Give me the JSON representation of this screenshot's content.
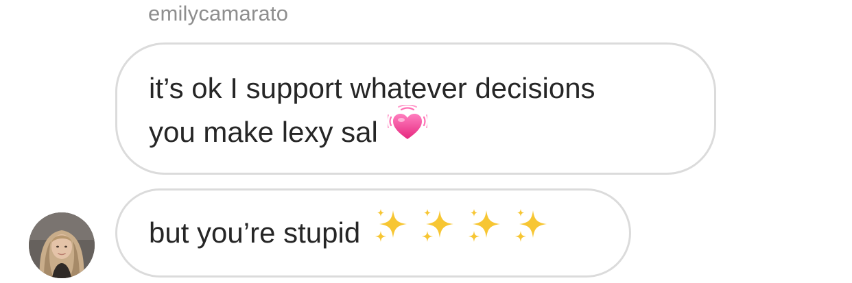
{
  "thread": {
    "sender_name": "emilycamarato",
    "messages": [
      {
        "lines": [
          "it’s ok I support whatever decisions",
          "you make lexy sal"
        ],
        "emoji": "beating-heart-icon"
      },
      {
        "lines": [
          "but you’re stupid"
        ],
        "emoji": "sparkles-icon",
        "emoji_count": 4
      }
    ],
    "avatar": "user-avatar"
  },
  "colors": {
    "bubble_border": "#dbdbdb",
    "text": "#262626",
    "username": "#8e8e8e",
    "heart": "#f0479a",
    "sparkle": "#f7c633"
  }
}
